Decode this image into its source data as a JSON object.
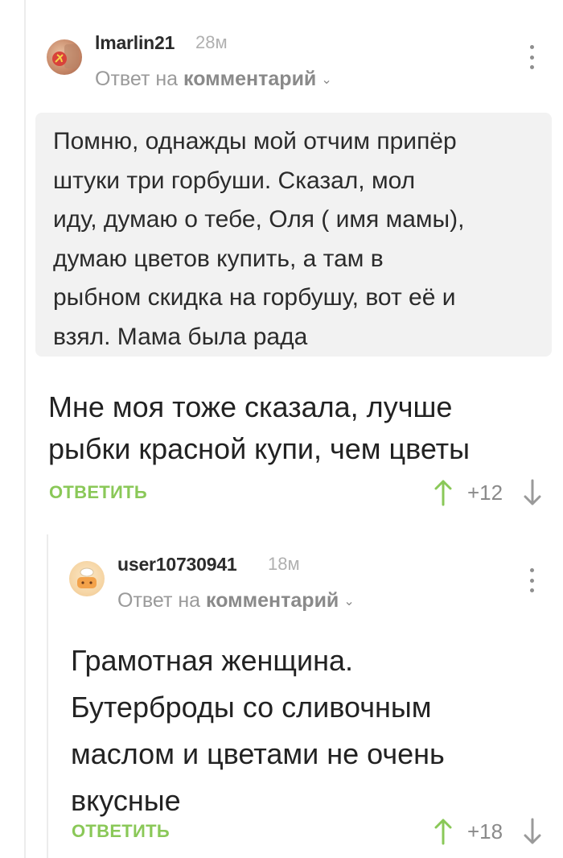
{
  "comment_1": {
    "username": "lmarlin21",
    "time": "28м",
    "reply_prefix": "Ответ на",
    "reply_target": "комментарий",
    "quote_lines": [
      "Помню, однажды мой отчим припёр",
      "штуки три горбуши. Сказал, мол",
      "иду, думаю о тебе, Оля ( имя мамы),",
      "думаю цветов купить, а там в",
      "рыбном скидка на горбушу, вот её и",
      "взял. Мама была рада"
    ],
    "text_lines": [
      "Мне моя тоже сказала, лучше",
      "рыбки красной купи, чем цветы"
    ],
    "reply_label": "ОТВЕТИТЬ",
    "rating": "+12"
  },
  "comment_2": {
    "username": "user10730941",
    "time": "18м",
    "reply_prefix": "Ответ на",
    "reply_target": "комментарий",
    "text_lines": [
      "Грамотная женщина.",
      "Бутерброды со сливочным",
      "маслом и цветами не очень",
      "вкусные"
    ],
    "reply_label": "ОТВЕТИТЬ",
    "rating": "+18"
  },
  "colors": {
    "accent_green": "#8ac858",
    "muted_gray": "#9a9a9a",
    "quote_bg": "#f2f2f2"
  },
  "icons": [
    "menu-dots-icon",
    "chevron-down-icon",
    "arrow-up-icon",
    "arrow-down-icon"
  ]
}
